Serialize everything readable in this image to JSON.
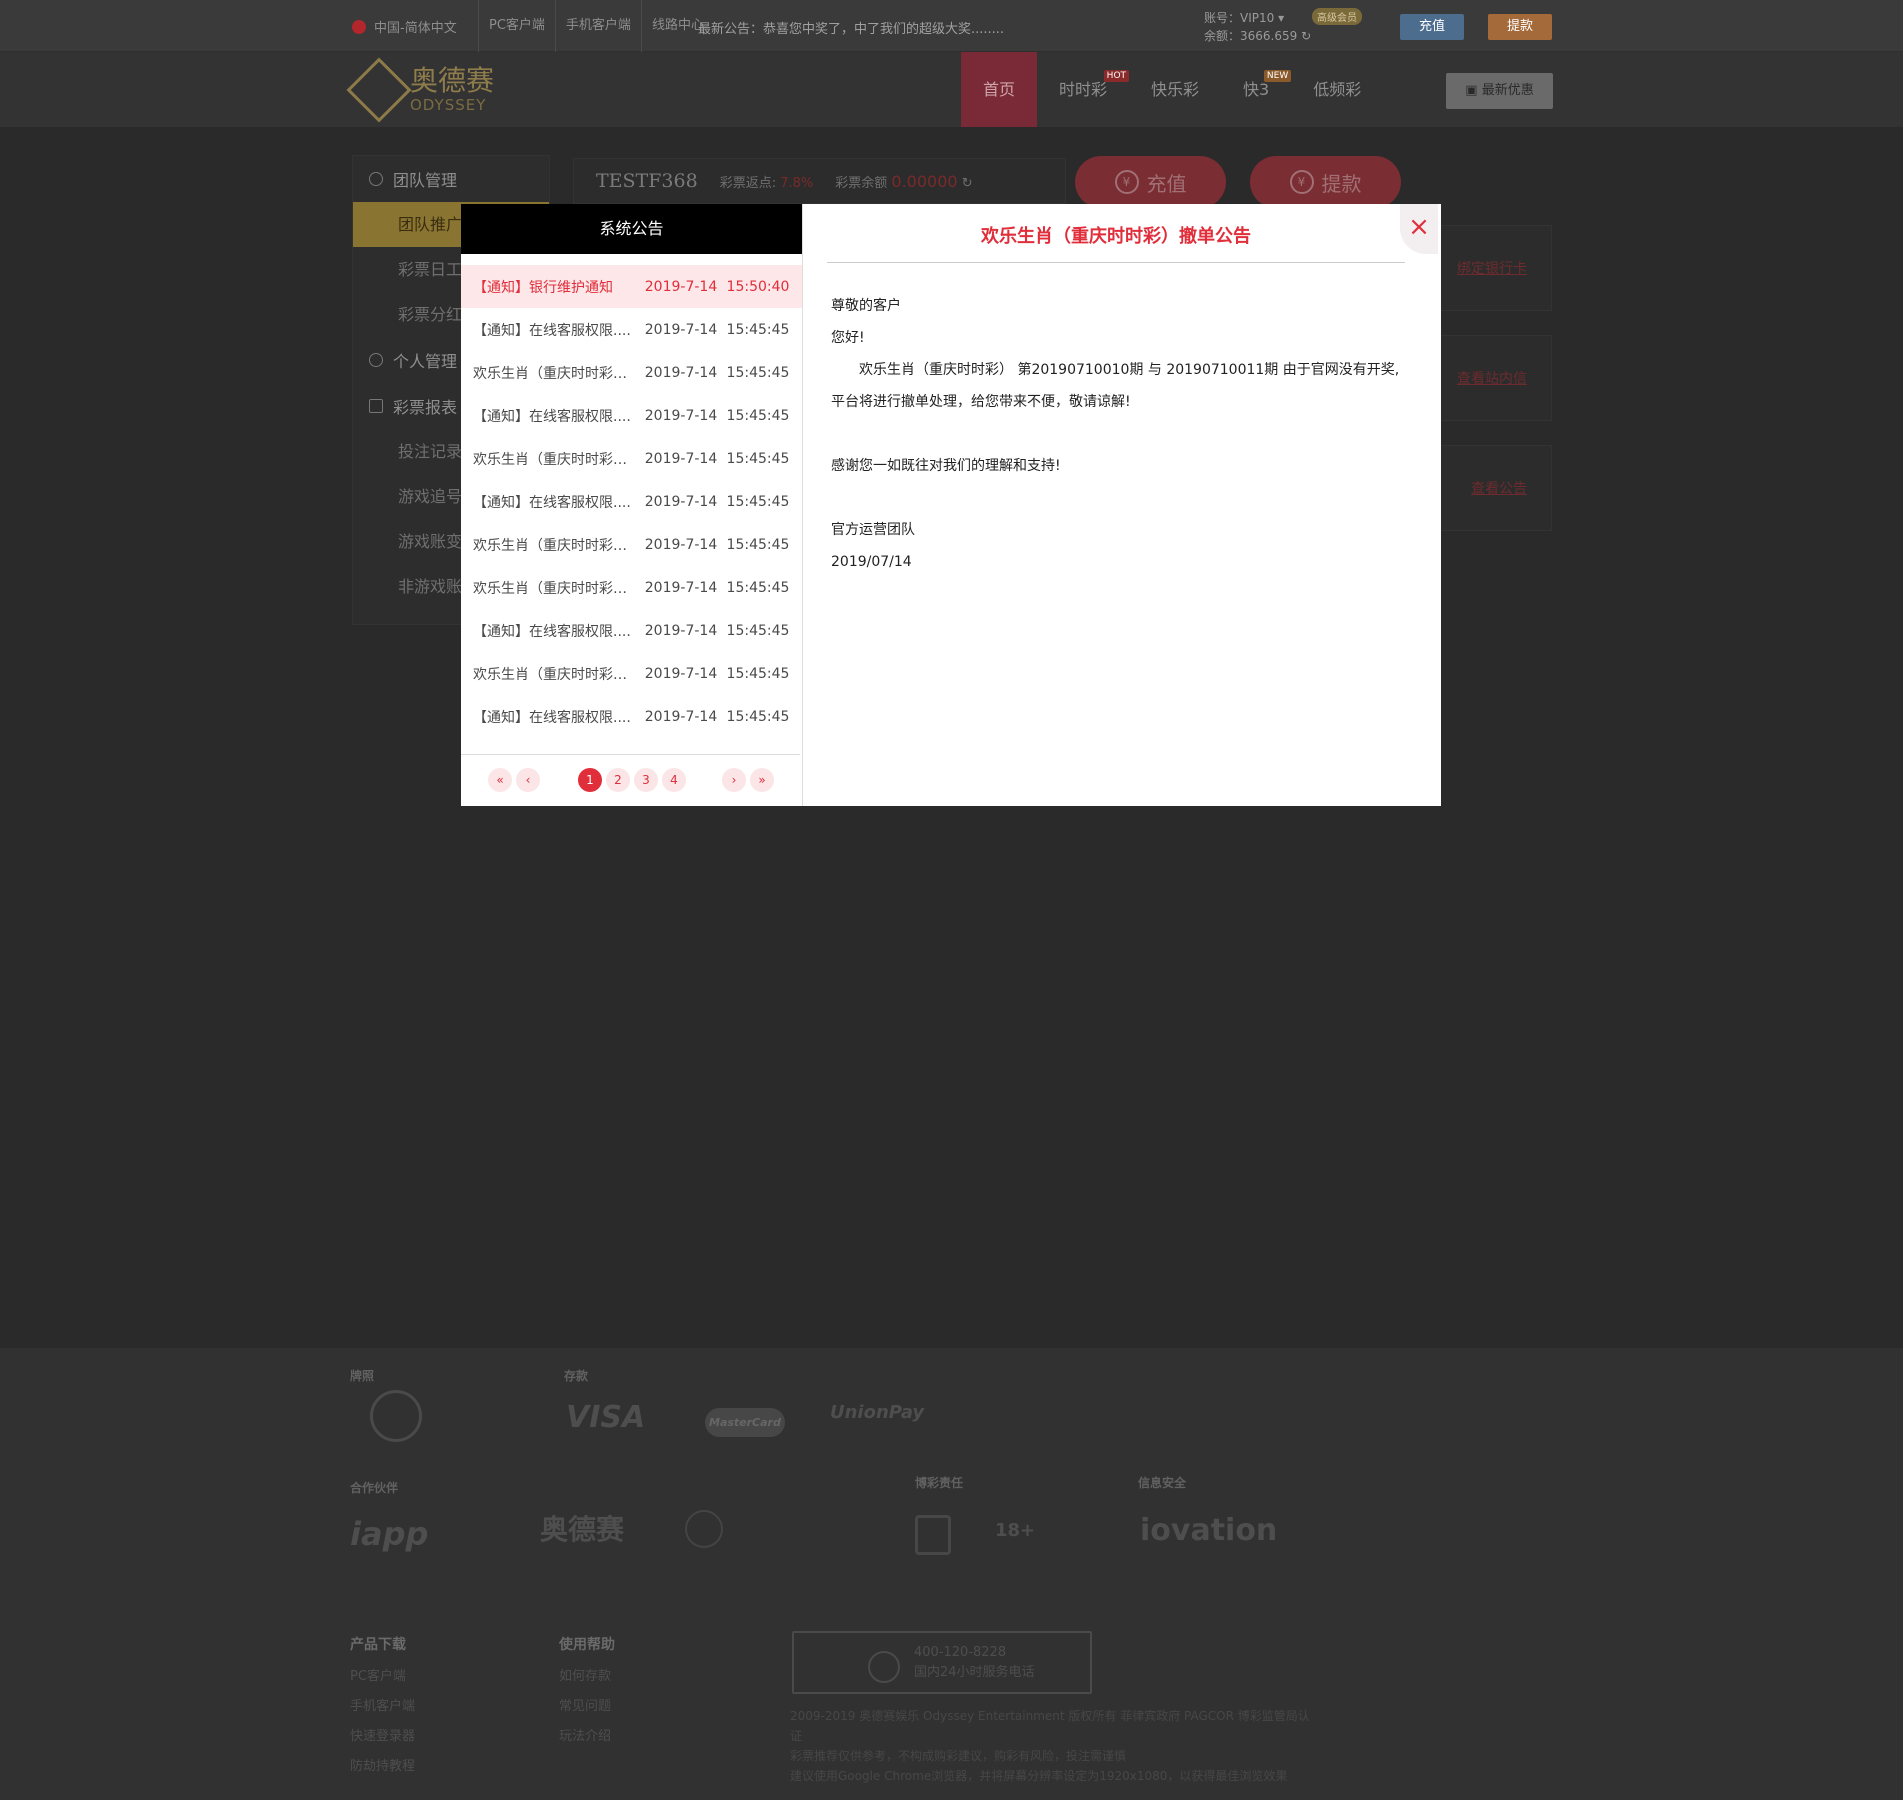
{
  "topbar": {
    "language": "中国-简体中文",
    "links": [
      "PC客户端",
      "手机客户端",
      "线路中心"
    ],
    "notice": "最新公告：恭喜您中奖了，中了我们的超级大奖........",
    "account_label": "账号：VIP10",
    "balance_label": "余额：3666.659",
    "vip_badge": "高级会员",
    "recharge": "充值",
    "withdraw": "提款"
  },
  "brand": {
    "cn": "奥德赛",
    "en": "ODYSSEY"
  },
  "nav": {
    "items": [
      {
        "label": "首页"
      },
      {
        "label": "时时彩",
        "tag": "HOT"
      },
      {
        "label": "快乐彩"
      },
      {
        "label": "快3",
        "tag": "NEW"
      },
      {
        "label": "低频彩"
      }
    ],
    "promo": "最新优惠"
  },
  "sidebar": {
    "group1": "团队管理",
    "group1_items": [
      "团队推广",
      "彩票日工",
      "彩票分红"
    ],
    "group2": "个人管理",
    "group3": "彩票报表",
    "group3_items": [
      "投注记录",
      "游戏追号",
      "游戏账变",
      "非游戏账"
    ]
  },
  "info": {
    "username": "TESTF368",
    "rebate_label": "彩票返点:",
    "rebate_value": "7.8%",
    "balance_label": "彩票余额",
    "balance_value": "0.00000",
    "recharge": "充值",
    "withdraw": "提款"
  },
  "side_links": [
    "绑定银行卡",
    "查看站内信",
    "查看公告"
  ],
  "modal": {
    "list_title": "系统公告",
    "notices": [
      {
        "title": "【通知】银行维护通知",
        "date": "2019-7-14",
        "time": "15:50:40"
      },
      {
        "title": "【通知】在线客服权限....",
        "date": "2019-7-14",
        "time": "15:45:45"
      },
      {
        "title": "欢乐生肖（重庆时时彩）...",
        "date": "2019-7-14",
        "time": "15:45:45"
      },
      {
        "title": "【通知】在线客服权限....",
        "date": "2019-7-14",
        "time": "15:45:45"
      },
      {
        "title": "欢乐生肖（重庆时时彩）...",
        "date": "2019-7-14",
        "time": "15:45:45"
      },
      {
        "title": "【通知】在线客服权限....",
        "date": "2019-7-14",
        "time": "15:45:45"
      },
      {
        "title": "欢乐生肖（重庆时时彩）...",
        "date": "2019-7-14",
        "time": "15:45:45"
      },
      {
        "title": "欢乐生肖（重庆时时彩）...",
        "date": "2019-7-14",
        "time": "15:45:45"
      },
      {
        "title": "【通知】在线客服权限....",
        "date": "2019-7-14",
        "time": "15:45:45"
      },
      {
        "title": "欢乐生肖（重庆时时彩）...",
        "date": "2019-7-14",
        "time": "15:45:45"
      },
      {
        "title": "【通知】在线客服权限....",
        "date": "2019-7-14",
        "time": "15:45:45"
      }
    ],
    "pager": {
      "first": "«",
      "prev": "‹",
      "pages": [
        "1",
        "2",
        "3",
        "4"
      ],
      "next": "›",
      "last": "»"
    },
    "article": {
      "title": "欢乐生肖（重庆时时彩）撤单公告",
      "greeting": "尊敬的客户",
      "hello": "您好!",
      "line1": "欢乐生肖（重庆时时彩） 第20190710010期 与 20190710011期 由于官网没有开奖,",
      "line2": "平台将进行撤单处理，给您带来不便，敬请谅解!",
      "thanks": "感谢您一如既往对我们的理解和支持!",
      "team": "官方运营团队",
      "date": "2019/07/14"
    },
    "close": "×"
  },
  "footer": {
    "license": "牌照",
    "deposit": "存款",
    "partners": "合作伙伴",
    "responsibility": "博彩责任",
    "security": "信息安全",
    "logos": [
      "VISA",
      "MasterCard",
      "UnionPay",
      "iapp",
      "奥德赛",
      "iovation",
      "18+"
    ],
    "col1_title": "产品下载",
    "col1": [
      "PC客户端",
      "手机客户端",
      "快速登录器",
      "防劫持教程"
    ],
    "col2_title": "使用帮助",
    "col2": [
      "如何存款",
      "常见问题",
      "玩法介绍"
    ],
    "hotline_number": "400-120-8228",
    "hotline_text": "国内24小时服务电话",
    "copyright1": "2009-2019 奥德赛娱乐 Odyssey Entertainment 版权所有 菲律宾政府 PAGCOR 博彩监管局认证",
    "copyright2": "彩票推荐仅供参考，不构成购彩建议，购彩有风险，投注需谨慎",
    "copyright3": "建议使用Google Chrome浏览器，并将屏幕分辨率设定为1920x1080，以获得最佳浏览效果"
  }
}
